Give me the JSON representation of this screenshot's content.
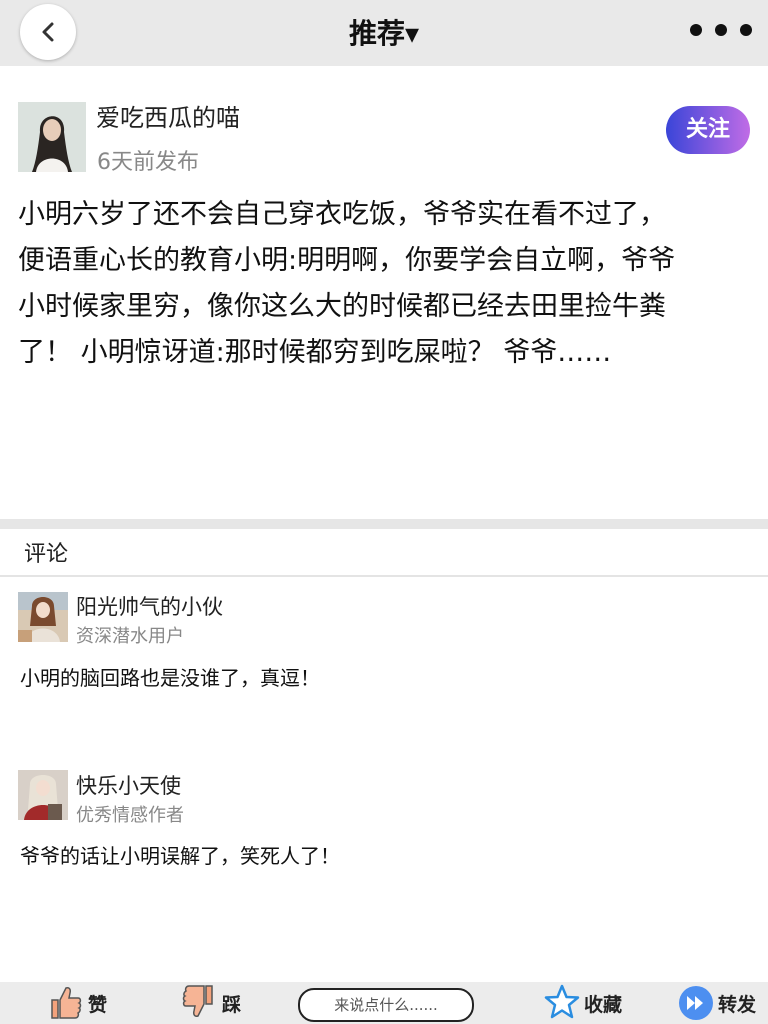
{
  "nav": {
    "title": "推荐▾"
  },
  "post": {
    "author": "爱吃西瓜的喵",
    "time": "6天前发布",
    "follow_label": "关注",
    "lines": [
      "小明六岁了还不会自己穿衣吃饭，爷爷实在看不过了，",
      "便语重心长的教育小明:明明啊，你要学会自立啊，爷爷",
      "小时候家里穷，像你这么大的时候都已经去田里捡牛粪",
      "了！ 小明惊讶道:那时候都穷到吃屎啦？ 爷爷……"
    ]
  },
  "comments": {
    "title": "评论",
    "items": [
      {
        "name": "阳光帅气的小伙",
        "tag": "资深潜水用户",
        "text": "小明的脑回路也是没谁了，真逗！"
      },
      {
        "name": "快乐小天使",
        "tag": "优秀情感作者",
        "text": "爷爷的话让小明误解了，笑死人了！"
      }
    ]
  },
  "bottom": {
    "like_label": "赞",
    "dislike_label": "踩",
    "input_placeholder": "来说点什么......",
    "collect_label": "收藏",
    "share_label": "转发"
  },
  "colors": {
    "follow_start": "#3a45d8",
    "follow_end": "#c06ce6",
    "like": "#f3a27c",
    "star": "#2a8de0",
    "share": "#4d8ff0"
  }
}
